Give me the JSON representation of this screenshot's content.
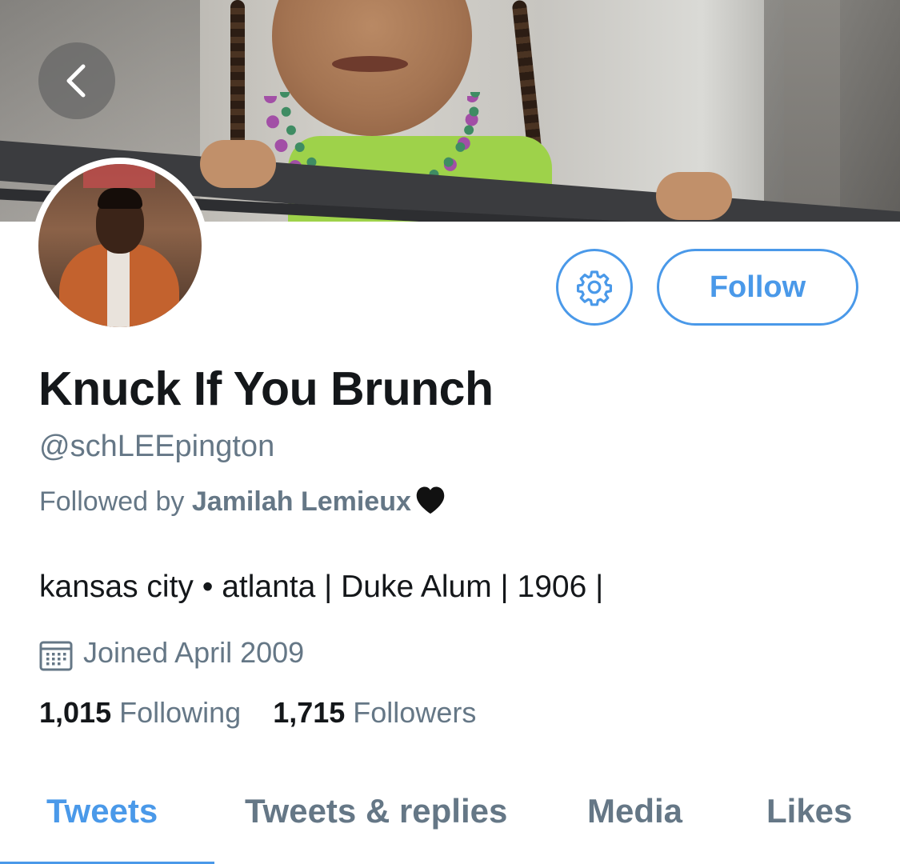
{
  "banner": {
    "image": "child-on-balcony-photo"
  },
  "nav": {
    "back_icon": "chevron-left-icon"
  },
  "profile": {
    "avatar": "profile-photo",
    "display_name": "Knuck If You Brunch",
    "handle": "@schLEEpington",
    "followed_by_prefix": "Followed by ",
    "followed_by_name": "Jamilah Lemieux",
    "followed_by_emoji_icon": "black-heart-icon",
    "bio": "kansas city • atlanta | Duke Alum | 1906 |",
    "joined": "Joined April 2009",
    "following_count": "1,015",
    "following_label": "Following",
    "followers_count": "1,715",
    "followers_label": "Followers"
  },
  "actions": {
    "settings_icon": "gear-icon",
    "follow_label": "Follow"
  },
  "tabs": [
    {
      "label": "Tweets",
      "active": true
    },
    {
      "label": "Tweets & replies",
      "active": false
    },
    {
      "label": "Media",
      "active": false
    },
    {
      "label": "Likes",
      "active": false
    }
  ],
  "colors": {
    "accent": "#4a99e9",
    "text_primary": "#14171a",
    "text_secondary": "#657786"
  }
}
